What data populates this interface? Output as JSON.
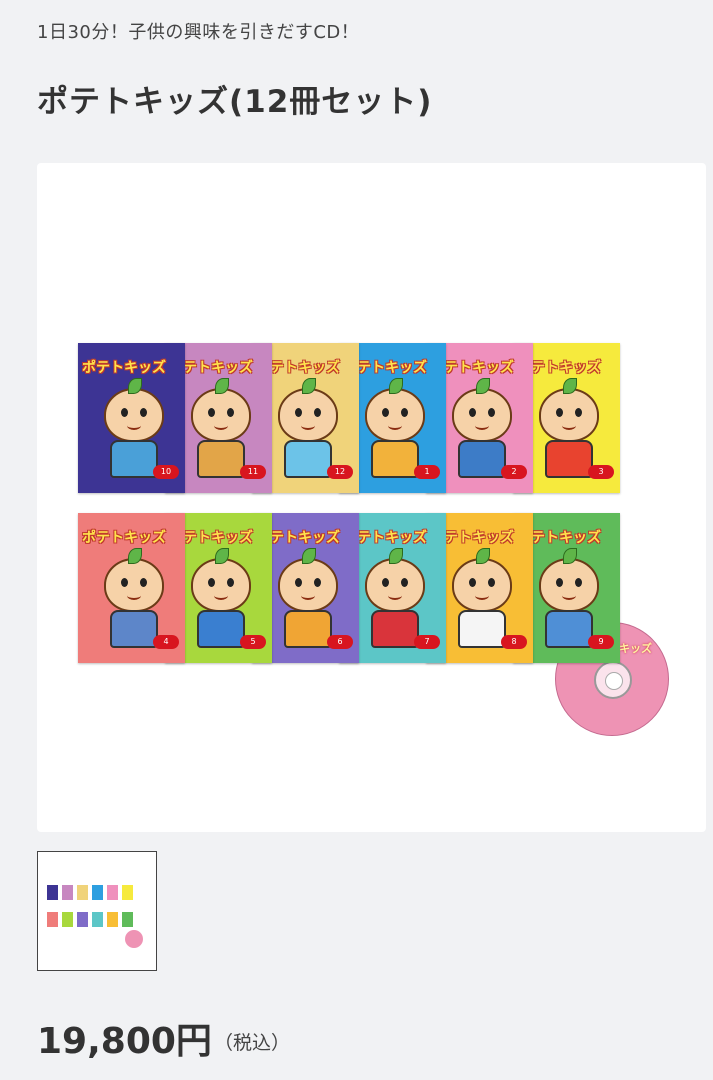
{
  "header": {
    "subtitle": "1日30分！子供の興味を引きだすCD！",
    "title": "ポテトキッズ(12冊セット)"
  },
  "product_image": {
    "books": [
      {
        "color": "#3d3494",
        "body": "#4aa0d8",
        "vol": "10"
      },
      {
        "color": "#c787c0",
        "body": "#e2a548",
        "vol": "11"
      },
      {
        "color": "#f0d37a",
        "body": "#6cc3e8",
        "vol": "12"
      },
      {
        "color": "#2d9fe0",
        "body": "#f2b23b",
        "vol": "1"
      },
      {
        "color": "#ef90bd",
        "body": "#3d7cc7",
        "vol": "2"
      },
      {
        "color": "#f6ea3d",
        "body": "#e8432f",
        "vol": "3"
      },
      {
        "color": "#ef7c7a",
        "body": "#5d86c9",
        "vol": "4"
      },
      {
        "color": "#a8d83d",
        "body": "#3a7fd0",
        "vol": "5"
      },
      {
        "color": "#7f6cc8",
        "body": "#f0a534",
        "vol": "6"
      },
      {
        "color": "#5cc6c7",
        "body": "#d9343b",
        "vol": "7"
      },
      {
        "color": "#f8be35",
        "body": "#f5f5f5",
        "vol": "8"
      },
      {
        "color": "#5fbb5a",
        "body": "#4f8fd6",
        "vol": "9"
      }
    ],
    "cover_logo": "ポテトキッズ",
    "cd_label": "ポテトキッズ"
  },
  "price": {
    "amount": "19,800円",
    "tax_note": "（税込）"
  }
}
